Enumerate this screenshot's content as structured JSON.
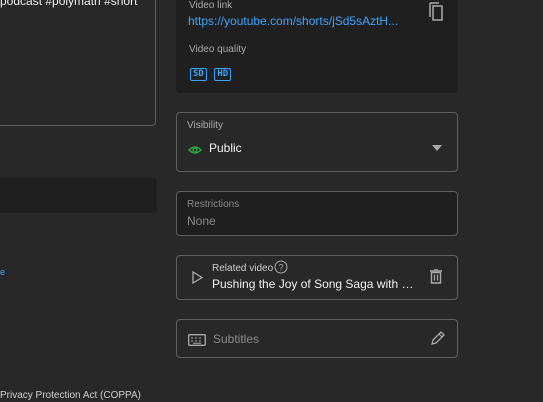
{
  "description": {
    "text": "podcast #polymath #short"
  },
  "left": {
    "link_text": "e",
    "coppa_text": "Privacy Protection Act (COPPA)"
  },
  "video_info": {
    "link_label": "Video link",
    "link_url": "https://youtube.com/shorts/jSd5sAztH...",
    "quality_label": "Video quality",
    "quality_badges": [
      "SD",
      "HD"
    ]
  },
  "visibility": {
    "label": "Visibility",
    "value": "Public"
  },
  "restrictions": {
    "label": "Restrictions",
    "value": "None"
  },
  "related_video": {
    "label": "Related video",
    "title": "Pushing the Joy of Song Saga with E..."
  },
  "subtitles": {
    "label": "Subtitles"
  },
  "colors": {
    "background": "#282828",
    "card": "#1f1f1f",
    "link": "#3ea6ff",
    "public_icon": "#2ba640"
  }
}
